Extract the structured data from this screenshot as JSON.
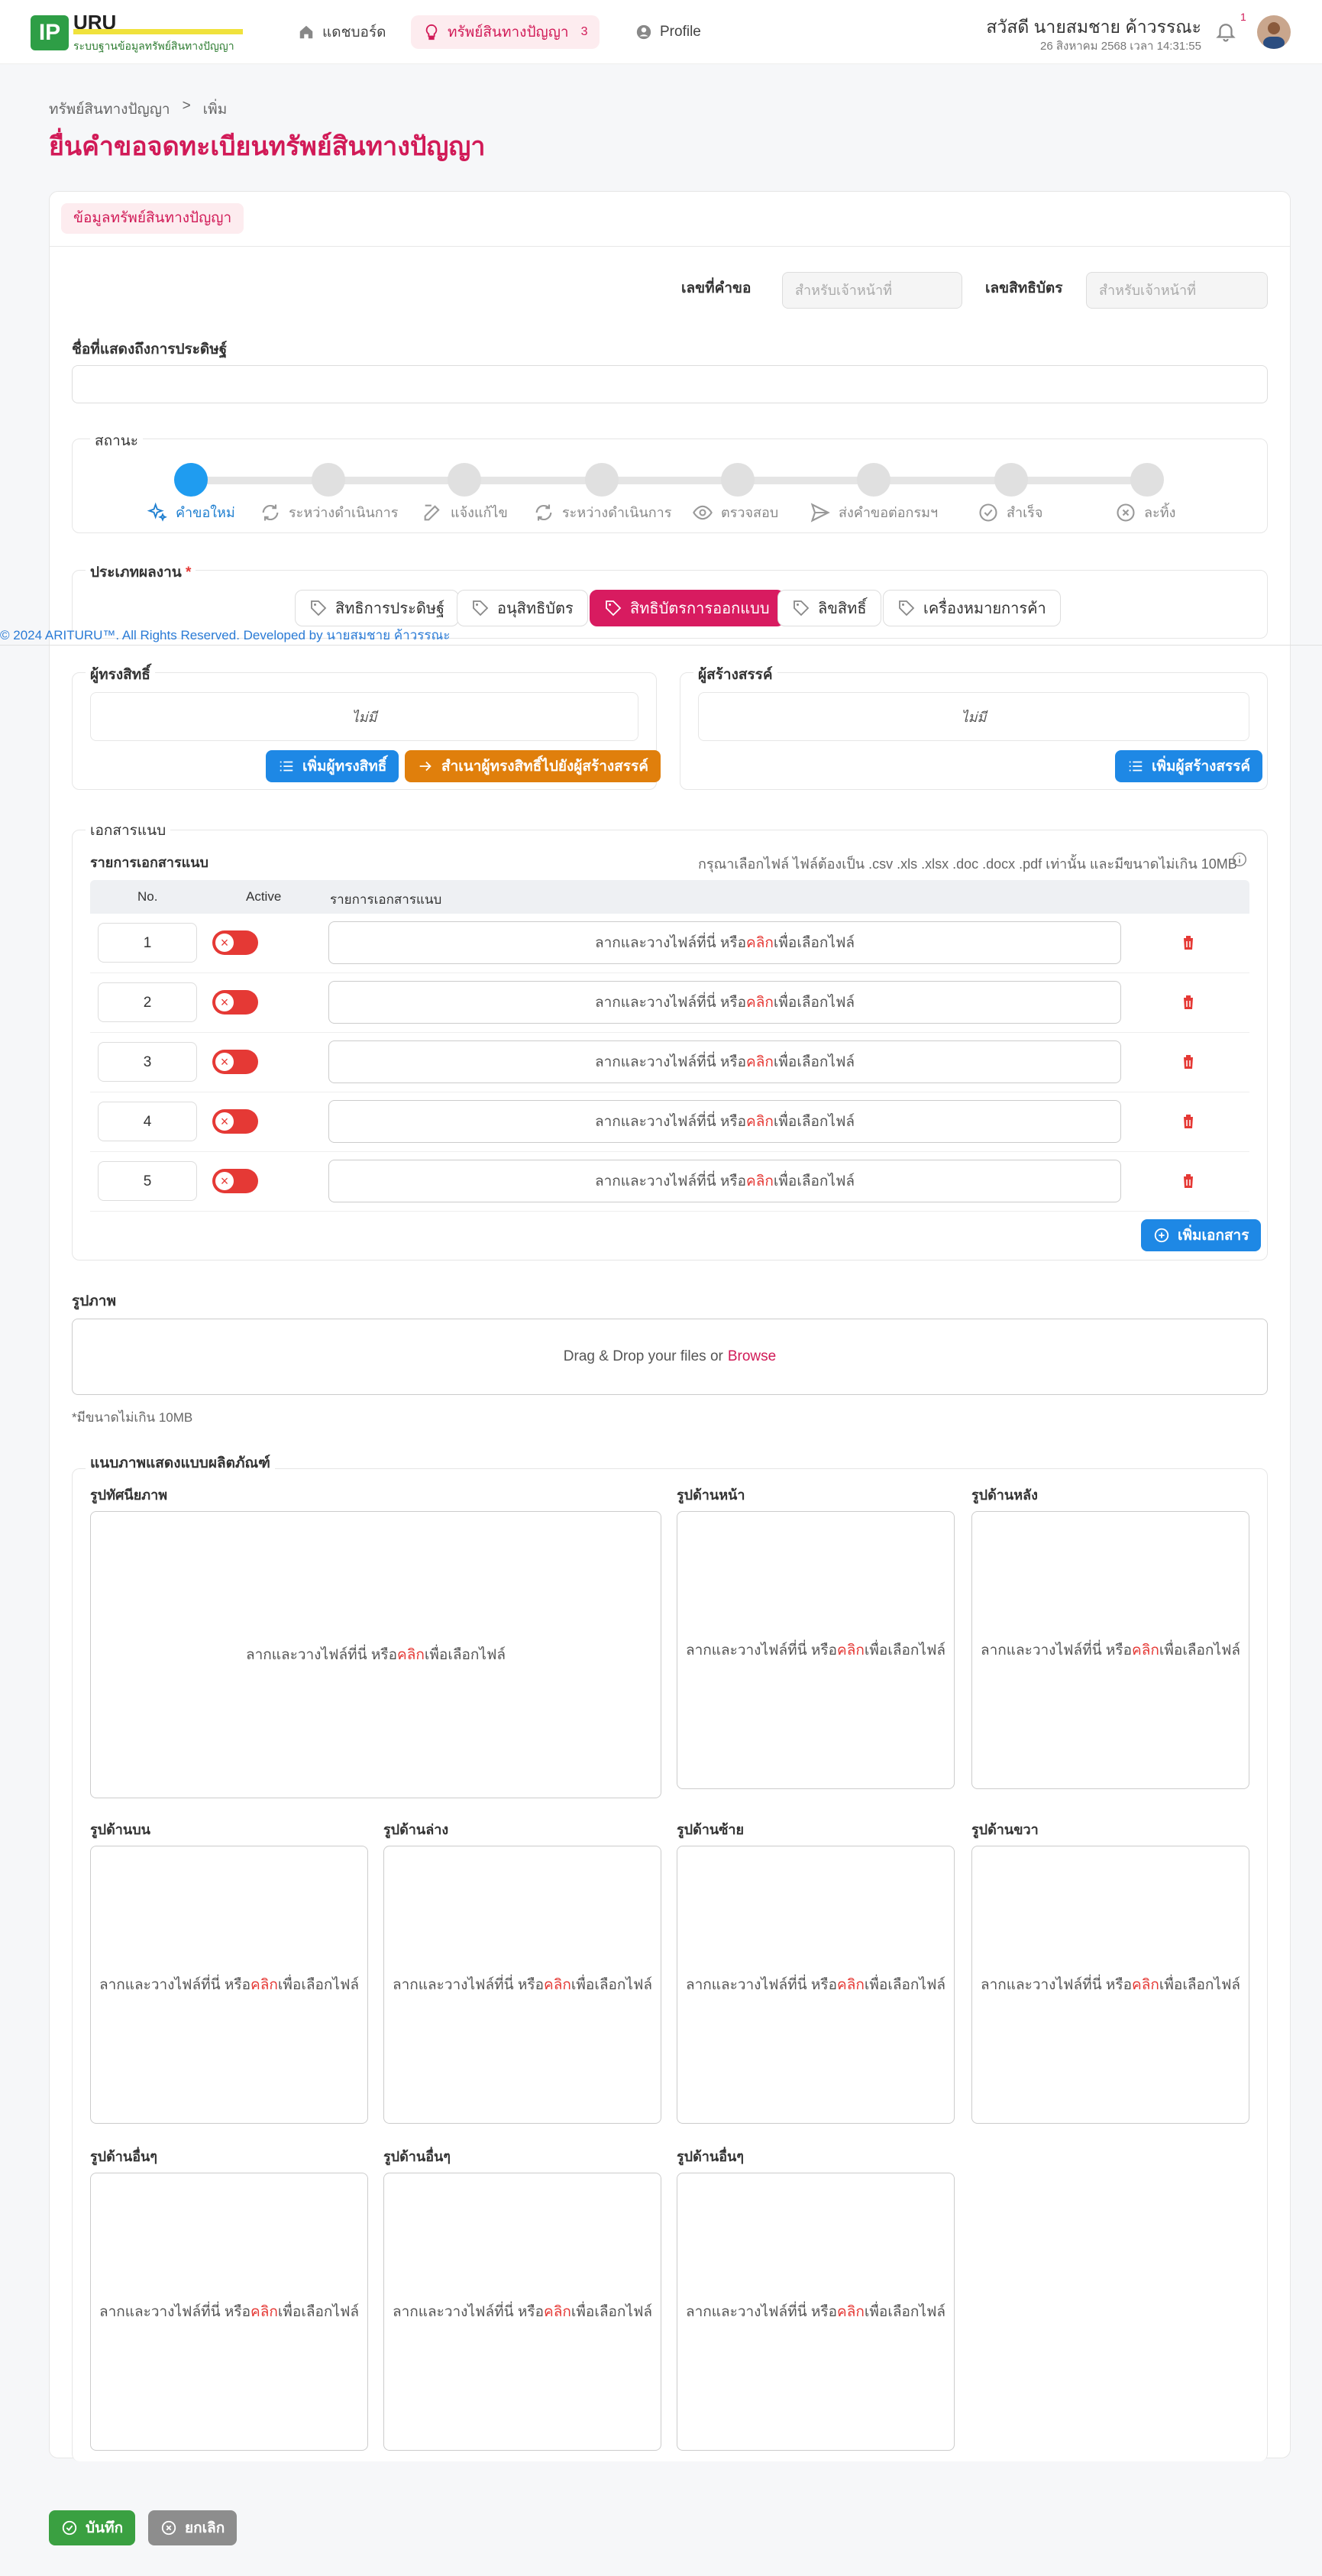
{
  "header": {
    "logo_badge": "IP",
    "logo_title": "URU",
    "logo_subtitle": "ระบบฐานข้อมูลทรัพย์สินทางปัญญา",
    "nav": [
      {
        "label": "แดชบอร์ด",
        "icon": "home-icon"
      },
      {
        "label": "ทรัพย์สินทางปัญญา",
        "icon": "lightbulb-icon",
        "count": "3"
      },
      {
        "label": "Profile",
        "icon": "user-circle-icon"
      }
    ],
    "greeting": "สวัสดี นายสมชาย ค้าวรรณะ",
    "datetime": "26 สิงหาคม 2568 เวลา 14:31:55",
    "notification_count": "1"
  },
  "breadcrumb": {
    "parent": "ทรัพย์สินทางปัญญา",
    "separator": ">",
    "current": "เพิ่ม"
  },
  "page_title": "ยื่นคำขอจดทะเบียนทรัพย์สินทางปัญญา",
  "section_tab": "ข้อมูลทรัพย์สินทางปัญญา",
  "form": {
    "request_no_label": "เลขที่คำขอ",
    "request_no_placeholder": "สำหรับเจ้าหน้าที่",
    "patent_no_label": "เลขสิทธิบัตร",
    "patent_no_placeholder": "สำหรับเจ้าหน้าที่",
    "invention_name_label": "ชื่อที่แสดงถึงการประดิษฐ์",
    "invention_name_value": ""
  },
  "status": {
    "label": "สถานะ",
    "steps": [
      "คำขอใหม่",
      "ระหว่างดำเนินการ",
      "แจ้งแก้ไข",
      "ระหว่างดำเนินการ",
      "ตรวจสอบ",
      "ส่งคำขอต่อกรมฯ",
      "สำเร็จ",
      "ละทิ้ง"
    ],
    "active_index": 0
  },
  "work_type": {
    "label": "ประเภทผลงาน",
    "required": "*",
    "options": [
      "สิทธิการประดิษฐ์",
      "อนุสิทธิบัตร",
      "สิทธิบัตรการออกแบบ",
      "ลิขสิทธิ์",
      "เครื่องหมายการค้า"
    ],
    "selected": "สิทธิบัตรการออกแบบ"
  },
  "footer_text": "© 2024 ARITURU™. All Rights Reserved. Developed by นายสมชาย ค้าวรรณะ",
  "owners": {
    "label": "ผู้ทรงสิทธิ์",
    "empty": "ไม่มี",
    "add_button": "เพิ่มผู้ทรงสิทธิ์",
    "copy_button": "สำเนาผู้ทรงสิทธิ์ไปยังผู้สร้างสรรค์"
  },
  "creators": {
    "label": "ผู้สร้างสรรค์",
    "empty": "ไม่มี",
    "add_button": "เพิ่มผู้สร้างสรรค์"
  },
  "attachments": {
    "label": "เอกสารแนบ",
    "list_label": "รายการเอกสารแนบ",
    "hint": "กรุณาเลือกไฟล์ ไฟล์ต้องเป็น .csv .xls .xlsx .doc .docx .pdf เท่านั้น และมีขนาดไม่เกิน 10MB",
    "columns": [
      "No.",
      "Active",
      "รายการเอกสารแนบ"
    ],
    "rows": [
      {
        "no": "1"
      },
      {
        "no": "2"
      },
      {
        "no": "3"
      },
      {
        "no": "4"
      },
      {
        "no": "5"
      }
    ],
    "drop_text_before": "ลากและวางไฟล์ที่นี่ หรือ",
    "drop_text_link": "คลิก",
    "drop_text_after": "เพื่อเลือกไฟล์",
    "add_button": "เพิ่มเอกสาร"
  },
  "images": {
    "label": "รูปภาพ",
    "drop_text": "Drag & Drop your files or",
    "browse": "Browse",
    "note": "*มีขนาดไม่เกิน 10MB"
  },
  "product_images": {
    "label": "แนบภาพแสดงแบบผลิตภัณฑ์",
    "slots": [
      "รูปทัศนียภาพ",
      "รูปด้านหน้า",
      "รูปด้านหลัง",
      "รูปด้านบน",
      "รูปด้านล่าง",
      "รูปด้านซ้าย",
      "รูปด้านขวา",
      "รูปด้านอื่นๆ",
      "รูปด้านอื่นๆ",
      "รูปด้านอื่นๆ"
    ]
  },
  "actions": {
    "save": "บันทึก",
    "cancel": "ยกเลิก"
  },
  "colors": {
    "brand": "#d11a57",
    "primary": "#1e88e5",
    "success": "#3aa041",
    "danger": "#e53935"
  }
}
